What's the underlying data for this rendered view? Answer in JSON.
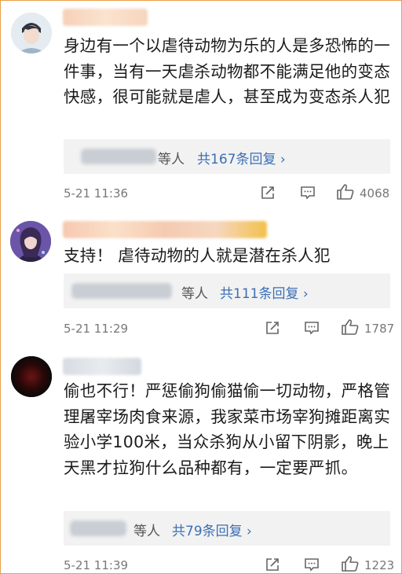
{
  "comments": [
    {
      "text": "身边有一个以虐待动物为乐的人是多恐怖的一件事，当有一天虐杀动物都不能满足他的变态快感，很可能就是虐人，甚至成为变态杀人犯",
      "reply_who": "等人",
      "reply_link": "共167条回复 ›",
      "time": "5-21 11:36",
      "likes": "4068"
    },
    {
      "text": "支持！ 虐待动物的人就是潜在杀人犯",
      "reply_who": "等人",
      "reply_link": "共111条回复 ›",
      "time": "5-21 11:29",
      "likes": "1787"
    },
    {
      "text": "偷也不行！严惩偷狗偷猫偷一切动物，严格管理屠宰场肉食来源，我家菜市场宰狗摊距离实验小学100米，当众杀狗从小留下阴影，晚上天黑才拉狗什么品种都有，一定要严抓。",
      "reply_who": "等人",
      "reply_link": "共79条回复 ›",
      "time": "5-21 11:39",
      "likes": "1223"
    }
  ],
  "icons": [
    "share-icon",
    "comment-icon",
    "like-icon"
  ]
}
